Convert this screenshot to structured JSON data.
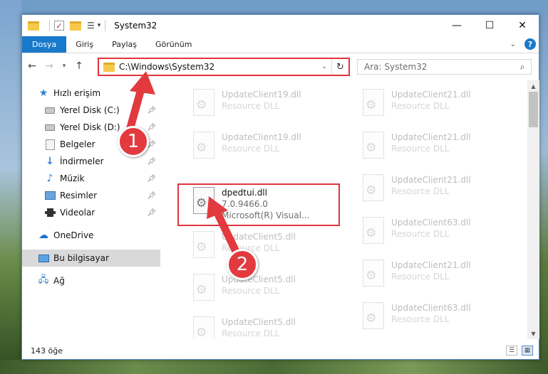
{
  "window": {
    "title": "System32",
    "minimize_label": "—",
    "maximize_label": "☐",
    "close_label": "✕"
  },
  "ribbon": {
    "tabs": [
      {
        "label": "Dosya"
      },
      {
        "label": "Giriş"
      },
      {
        "label": "Paylaş"
      },
      {
        "label": "Görünüm"
      }
    ],
    "help_label": "?"
  },
  "navbar": {
    "address": "C:\\Windows\\System32",
    "search_placeholder": "Ara: System32"
  },
  "sidebar": {
    "items": [
      {
        "label": "Hızlı erişim"
      },
      {
        "label": "Yerel Disk (C:)"
      },
      {
        "label": "Yerel Disk (D:)"
      },
      {
        "label": "Belgeler"
      },
      {
        "label": "İndirmeler"
      },
      {
        "label": "Müzik"
      },
      {
        "label": "Resimler"
      },
      {
        "label": "Videolar"
      },
      {
        "label": "OneDrive"
      },
      {
        "label": "Bu bilgisayar"
      },
      {
        "label": "Ağ"
      }
    ]
  },
  "files": {
    "left": [
      {
        "name": "UpdateClient19.dll",
        "desc": "Resource DLL"
      },
      {
        "name": "UpdateClient19.dll",
        "desc": "Resource DLL"
      },
      {
        "name": "dpedtui.dll",
        "version": "7.0.9466.0",
        "company": "Microsoft(R) Visual..."
      },
      {
        "name": "UpdateClient5.dll",
        "desc": "Resource DLL"
      },
      {
        "name": "UpdateClient5.dll",
        "desc": "Resource DLL"
      },
      {
        "name": "UpdateClient5.dll",
        "desc": "Resource DLL"
      }
    ],
    "right": [
      {
        "name": "UpdateClient21.dll",
        "desc": "Resource DLL"
      },
      {
        "name": "UpdateClient21.dll",
        "desc": "Resource DLL"
      },
      {
        "name": "UpdateClient21.dll",
        "desc": "Resource DLL"
      },
      {
        "name": "UpdateClient63.dll",
        "desc": "Resource DLL"
      },
      {
        "name": "UpdateClient21.dll",
        "desc": "Resource DLL"
      },
      {
        "name": "UpdateClient63.dll",
        "desc": "Resource DLL"
      }
    ]
  },
  "status": {
    "item_count": "143 öğe"
  },
  "annotations": {
    "step1": "1",
    "step2": "2"
  },
  "colors": {
    "accent": "#1979ca",
    "annotation_red": "#e23a3f"
  }
}
